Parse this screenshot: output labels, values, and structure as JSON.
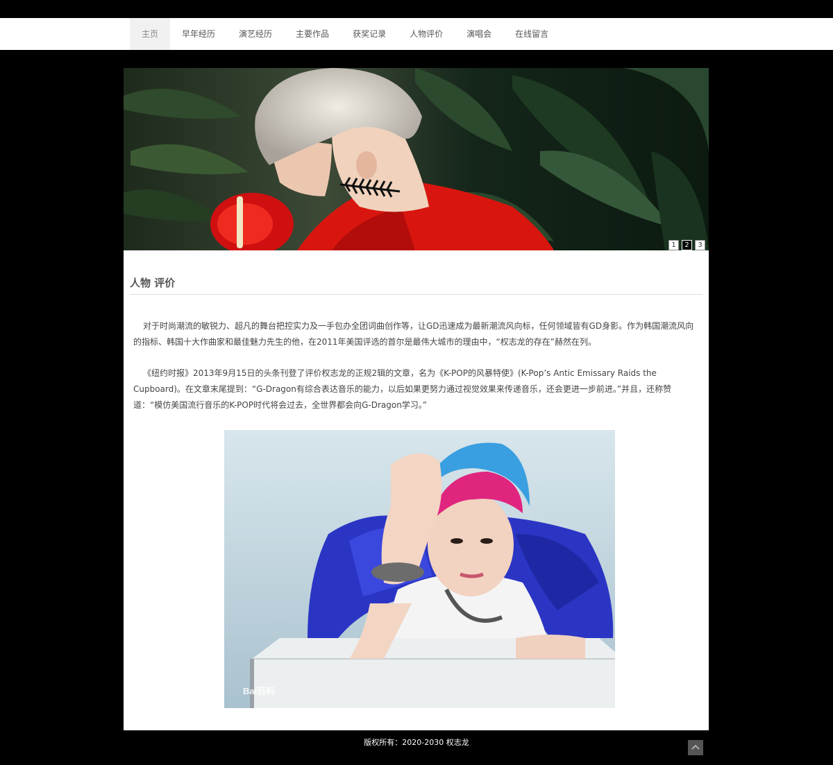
{
  "nav": {
    "items": [
      {
        "label": "主页",
        "active": true
      },
      {
        "label": "早年经历",
        "active": false
      },
      {
        "label": "演艺经历",
        "active": false
      },
      {
        "label": "主要作品",
        "active": false
      },
      {
        "label": "获奖记录",
        "active": false
      },
      {
        "label": "人物评价",
        "active": false
      },
      {
        "label": "演唱会",
        "active": false
      },
      {
        "label": "在线留言",
        "active": false
      }
    ]
  },
  "banner": {
    "pager": [
      "1",
      "2",
      "3"
    ],
    "active_page": "2"
  },
  "main": {
    "title": "人物 评价",
    "paragraphs": [
      "对于时尚潮流的敏锐力、超凡的舞台把控实力及一手包办全团词曲创作等，让GD迅速成为最新潮流风向标，任何领域皆有GD身影。作为韩国潮流风向的指标、韩国十大作曲家和最佳魅力先生的他，在2011年美国评选的首尔是最伟大城市的理由中，“权志龙的存在”赫然在列。",
      "《纽约时报》2013年9月15日的头条刊登了评价权志龙的正规2辑的文章，名为《K-POP的风暴特使》(K-Pop’s Antic Emissary Raids the Cupboard)。在文章末尾提到：“G-Dragon有综合表达音乐的能力，以后如果更努力通过视觉效果来传递音乐，还会更进一步前进。”并且，还称赞道：“模仿美国流行音乐的K-POP时代将会过去，全世界都会向G-Dragon学习。”"
    ],
    "photo_watermark": "Bai百科"
  },
  "footer": {
    "copyright": "版权所有：2020-2030 权志龙"
  },
  "icons": {
    "back_to_top": "chevron-up-icon"
  },
  "colors": {
    "page_bg": "#000000",
    "content_bg": "#ffffff",
    "nav_active_bg": "#f1f1f1"
  }
}
